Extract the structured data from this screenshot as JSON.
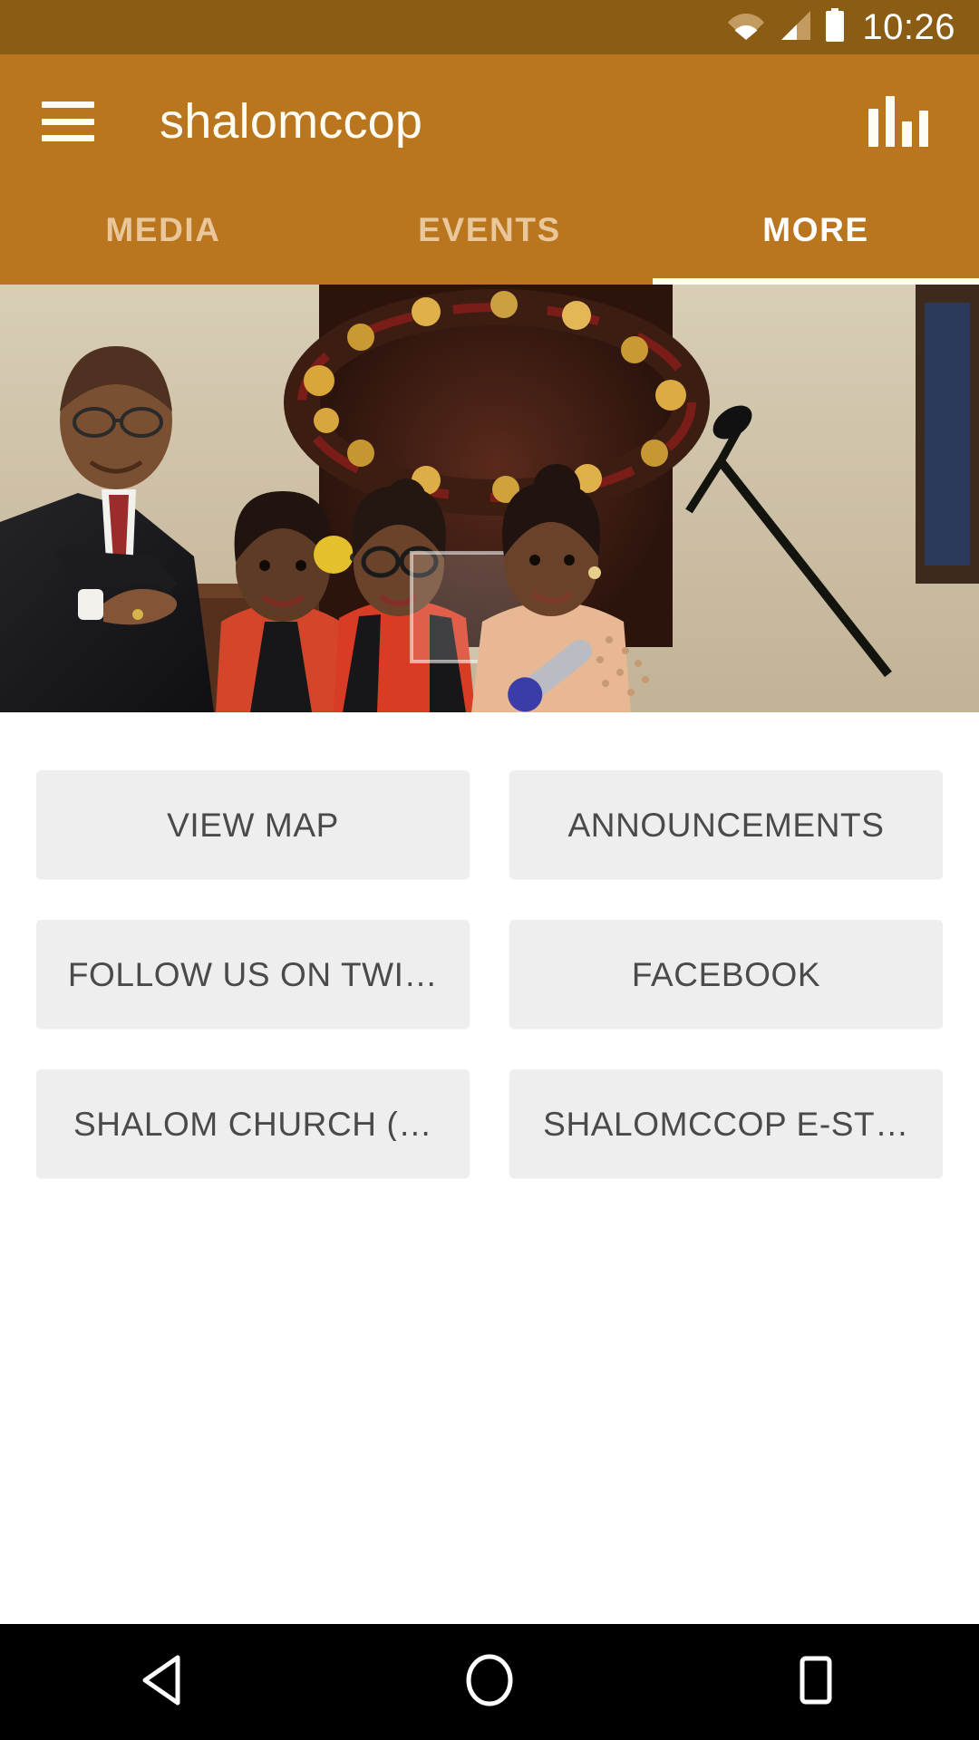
{
  "status_bar": {
    "time": "10:26",
    "icons": [
      "wifi-icon",
      "cellular-signal-icon",
      "battery-icon"
    ],
    "background_color": "#8a5c14"
  },
  "app_bar": {
    "title": "shalomccop",
    "menu_icon": "hamburger-menu-icon",
    "action_icon": "equalizer-chart-icon",
    "background_color": "#b9761f",
    "text_color": "#fffdf3"
  },
  "tabs": {
    "active_index": 2,
    "indicator_color": "#fffdf3",
    "inactive_color": "#e9c79b",
    "active_color": "#ffffff",
    "items": [
      {
        "label": "MEDIA",
        "active": false
      },
      {
        "label": "EVENTS",
        "active": false
      },
      {
        "label": "MORE",
        "active": true
      }
    ]
  },
  "hero": {
    "alt": "pastor pointing with three young girl singers at church microphone with christmas wreath"
  },
  "more_grid": {
    "button_background": "#eeeeee",
    "button_text_color": "#4a4a4a",
    "buttons": [
      {
        "label": "VIEW MAP"
      },
      {
        "label": "ANNOUNCEMENTS"
      },
      {
        "label": "FOLLOW US ON TWI…"
      },
      {
        "label": "FACEBOOK"
      },
      {
        "label": "SHALOM CHURCH (…"
      },
      {
        "label": "SHALOMCCOP E-ST…"
      }
    ]
  },
  "nav_bar": {
    "background_color": "#000000",
    "buttons": [
      {
        "name": "back-button"
      },
      {
        "name": "home-button"
      },
      {
        "name": "recents-button"
      }
    ]
  }
}
